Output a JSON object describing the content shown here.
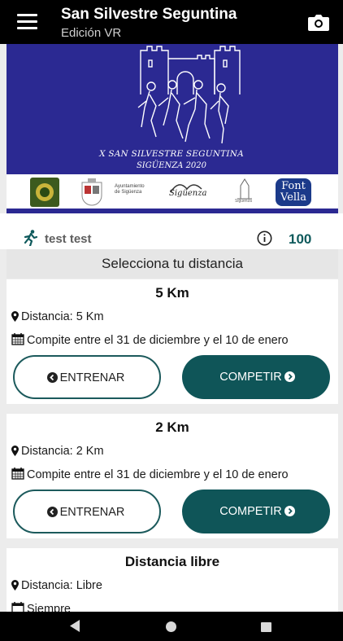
{
  "appbar": {
    "title": "San Silvestre Seguntina",
    "subtitle": "Edición VR",
    "menu_icon": "hamburger-menu-icon",
    "camera_icon": "camera-icon"
  },
  "banner": {
    "line1": "X SAN SILVESTRE SEGUNTINA",
    "line2": "SIGÜENZA 2020",
    "background": "#2b2992",
    "sponsors": {
      "ayuntamiento": "Ayuntamiento de Sigüenza",
      "siguenza_logo": "Sigüenza",
      "siguenza_small": "Sigüenza",
      "fontvella_line1": "Font",
      "fontvella_line2": "Vella"
    }
  },
  "user": {
    "name": "test test",
    "score": "100"
  },
  "section_header": "Selecciona tu distancia",
  "distances": [
    {
      "title": "5 Km",
      "distance": "Distancia: 5 Km",
      "dates": "Compite entre el 31 de diciembre y el 10 de enero",
      "train_label": "ENTRENAR",
      "compete_label": "COMPETIR"
    },
    {
      "title": "2 Km",
      "distance": "Distancia: 2 Km",
      "dates": "Compite entre el 31 de diciembre y el 10 de enero",
      "train_label": "ENTRENAR",
      "compete_label": "COMPETIR"
    },
    {
      "title": "Distancia libre",
      "distance": "Distancia: Libre",
      "dates": "Siempre"
    }
  ],
  "colors": {
    "accent": "#0f5558",
    "score": "#0f5a5c",
    "appbar": "#000000"
  }
}
